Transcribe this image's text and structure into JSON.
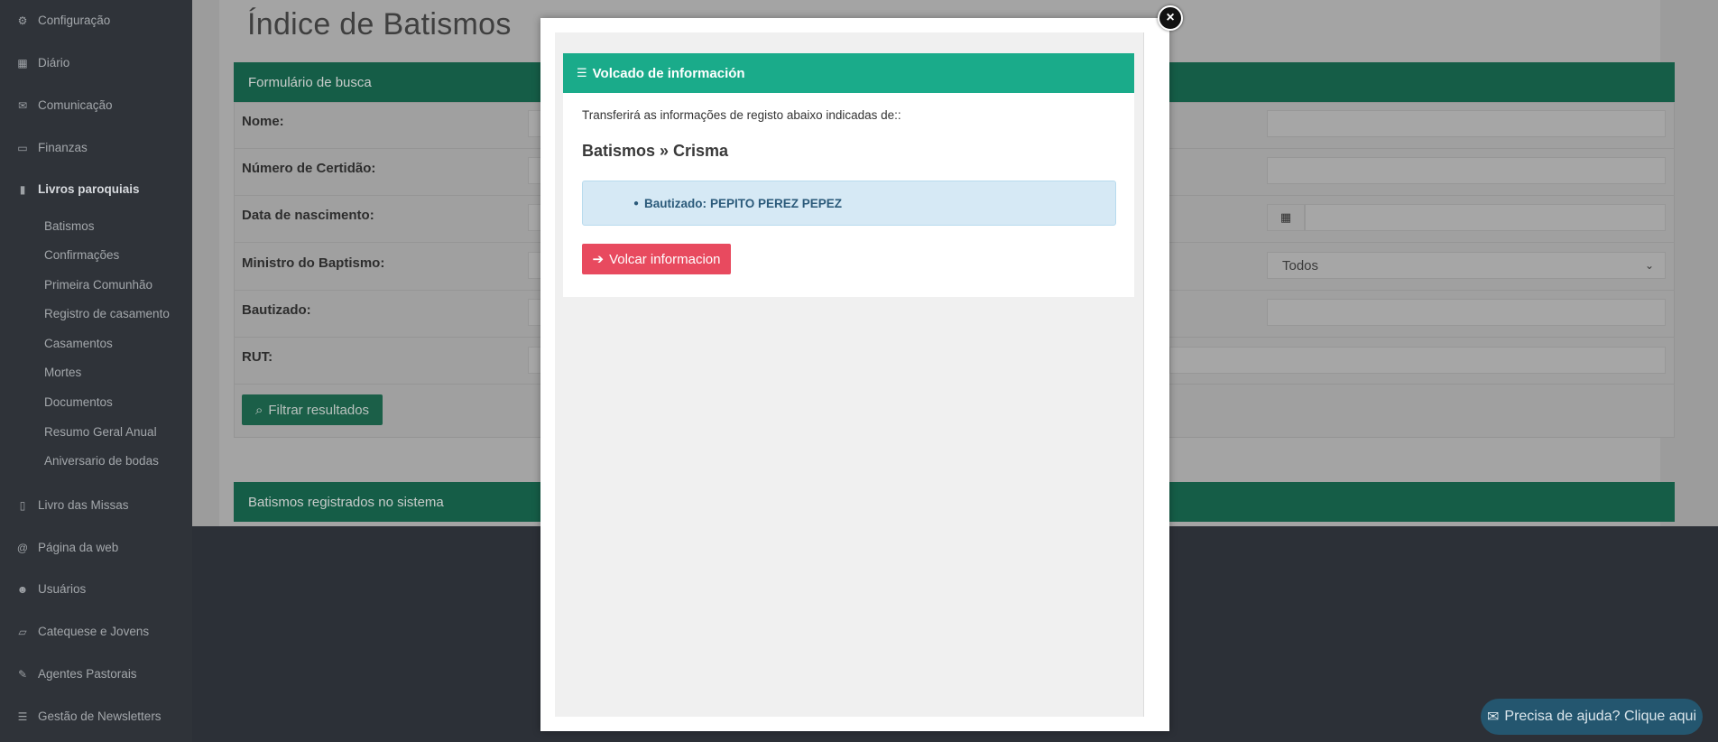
{
  "sidebar": {
    "items": [
      {
        "label": "Configuração",
        "icon": "gears-icon"
      },
      {
        "label": "Diário",
        "icon": "calendar-icon"
      },
      {
        "label": "Comunicação",
        "icon": "envelope-icon"
      },
      {
        "label": "Finanzas",
        "icon": "money-icon"
      },
      {
        "label": "Livros paroquiais",
        "icon": "book-icon"
      },
      {
        "label": "Livro das Missas",
        "icon": "bookmark-icon"
      },
      {
        "label": "Página da web",
        "icon": "at-icon"
      },
      {
        "label": "Usuários",
        "icon": "users-icon"
      },
      {
        "label": "Catequese e Jovens",
        "icon": "folder-open-icon"
      },
      {
        "label": "Agentes Pastorais",
        "icon": "wrench-icon"
      },
      {
        "label": "Gestão de Newsletters",
        "icon": "list-icon"
      }
    ],
    "subitems": [
      "Batismos",
      "Confirmações",
      "Primeira Comunhão",
      "Registro de casamento",
      "Casamentos",
      "Mortes",
      "Documentos",
      "Resumo Geral Anual",
      "Aniversario de bodas"
    ]
  },
  "main": {
    "title": "Índice de Batismos",
    "search_header": "Formulário de busca",
    "labels": {
      "nome": "Nome:",
      "certidao": "Número de Certidão:",
      "nascimento": "Data de nascimento:",
      "ministro": "Ministro do Baptismo:",
      "bautizado": "Bautizado:",
      "rut": "RUT:"
    },
    "ministro_select_value": "Todos",
    "filter_button": "Filtrar resultados",
    "list_header": "Batismos registrados no sistema"
  },
  "modal": {
    "header": "Volcado de información",
    "text": "Transferirá as informações de registo abaixo indicadas de::",
    "heading": "Batismos » Crisma",
    "info_label": "Bautizado:",
    "info_value": "PEPITO PEREZ PEPEZ",
    "button": "Volcar informacion",
    "close_glyph": "×"
  },
  "help": {
    "label": "Precisa de ajuda? Clique aqui"
  },
  "colors": {
    "accent": "#1aab8a",
    "danger": "#e84a5f",
    "info_bg": "#d6e9f5",
    "sidebar_bg": "#2f3339",
    "help_bg": "#24566f"
  }
}
